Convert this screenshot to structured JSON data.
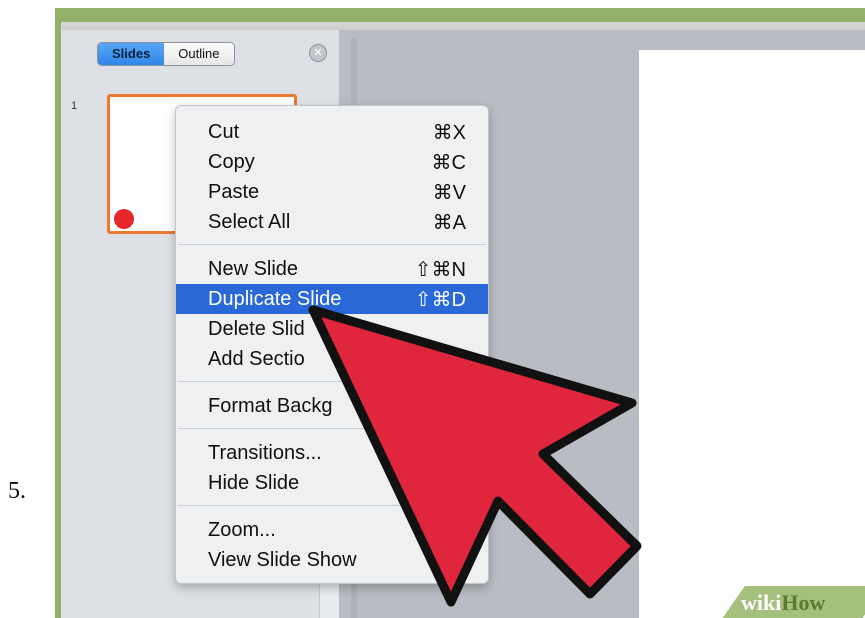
{
  "step": {
    "number": "5."
  },
  "panel": {
    "tabs": [
      {
        "label": "Slides",
        "active": true
      },
      {
        "label": "Outline",
        "active": false
      }
    ],
    "close_icon": "close-circle-icon",
    "slide_number": "1"
  },
  "context_menu": {
    "groups": [
      [
        {
          "label": "Cut",
          "shortcut": "⌘X"
        },
        {
          "label": "Copy",
          "shortcut": "⌘C"
        },
        {
          "label": "Paste",
          "shortcut": "⌘V"
        },
        {
          "label": "Select All",
          "shortcut": "⌘A"
        }
      ],
      [
        {
          "label": "New Slide",
          "shortcut": "⇧⌘N"
        },
        {
          "label": "Duplicate Slide",
          "shortcut": "⇧⌘D",
          "highlighted": true
        },
        {
          "label": "Delete Slid",
          "shortcut": ""
        },
        {
          "label": "Add Sectio",
          "shortcut": ""
        }
      ],
      [
        {
          "label": "Format Backg",
          "shortcut": ""
        }
      ],
      [
        {
          "label": "Transitions...",
          "shortcut": ""
        },
        {
          "label": "Hide Slide",
          "shortcut": ""
        }
      ],
      [
        {
          "label": "Zoom...",
          "shortcut": ""
        },
        {
          "label": "View Slide Show",
          "shortcut": ""
        }
      ]
    ]
  },
  "watermark": {
    "wiki": "wiki",
    "how": "How"
  },
  "colors": {
    "highlight": "#2a68d8",
    "arrow": "#e0263c",
    "thumbnail_border": "#ec7a2e",
    "tab_active": "#3d8fed"
  }
}
